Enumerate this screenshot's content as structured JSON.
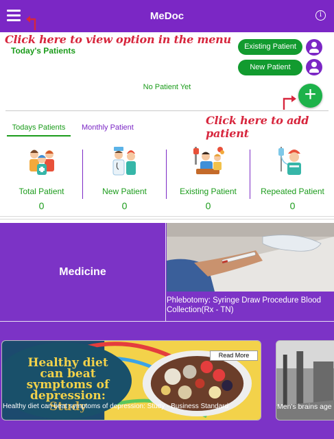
{
  "app": {
    "title": "MeDoc"
  },
  "header": {
    "menu_icon": "hamburger-menu-icon",
    "info_icon": "info-icon",
    "info_glyph": "i"
  },
  "annotations": {
    "menu_hint": "Click here to view option in the menu",
    "add_hint": "Click here to add patient",
    "color": "#d7263d"
  },
  "today": {
    "title": "Today's Patients",
    "existing_button": "Existing Patient",
    "new_button": "New Patient",
    "empty_message": "No Patient Yet",
    "add_icon": "plus-icon",
    "add_glyph": "+"
  },
  "tabs": [
    {
      "label": "Todays Patients",
      "active": true
    },
    {
      "label": "Monthly Patient",
      "active": false
    }
  ],
  "stats": [
    {
      "label": "Total Patient",
      "value": "0",
      "icon": "family-group-icon"
    },
    {
      "label": "New Patient",
      "value": "0",
      "icon": "doctor-patient-icon"
    },
    {
      "label": "Existing Patient",
      "value": "0",
      "icon": "patient-with-visitor-icon"
    },
    {
      "label": "Repeated Patient",
      "value": "0",
      "icon": "patient-drip-icon"
    }
  ],
  "tiles": {
    "medicine": "Medicine",
    "video_caption": "Phlebotomy: Syringe Draw Procedure Blood Collection(Rx - TN)"
  },
  "news": [
    {
      "caption": "Healthy diet can beat symptoms of depression: Study - Business Standard",
      "image_text": [
        "Healthy diet",
        "can beat",
        "symptoms of",
        "depression:",
        "Study"
      ],
      "read_more": "Read More"
    },
    {
      "caption": "Men's brains age"
    }
  ],
  "colors": {
    "primary_purple": "#7b27c5",
    "accent_green": "#1a9b1a",
    "button_green": "#129b2f",
    "fab_green": "#1db24a"
  }
}
